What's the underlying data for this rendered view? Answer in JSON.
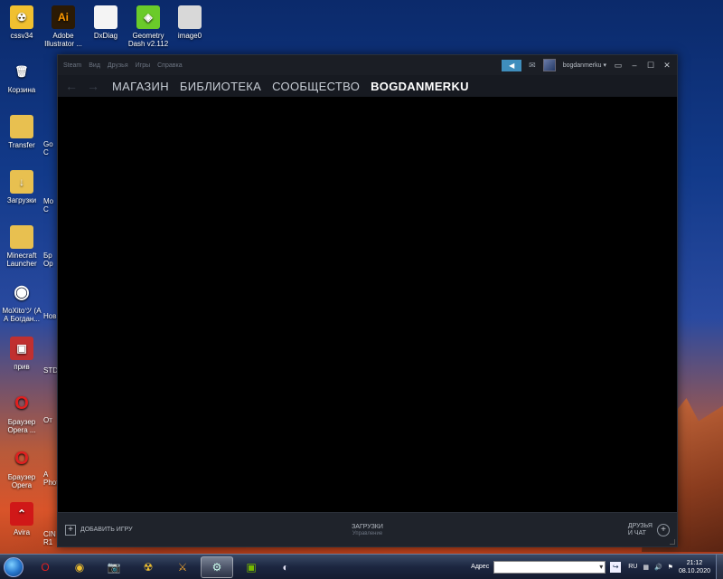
{
  "desktop": {
    "icons": [
      {
        "label": "cssv34",
        "icon": "cs-icon",
        "glyph": "☢",
        "bg": "#f0c030"
      },
      {
        "label": "Adobe Illustrator ...",
        "icon": "illustrator-icon",
        "glyph": "Ai",
        "bg": "#2b1a05"
      },
      {
        "label": "DxDiag",
        "icon": "file-icon",
        "glyph": "",
        "bg": "#f4f4f4"
      },
      {
        "label": "Geometry Dash v2.112",
        "icon": "geometry-dash-icon",
        "glyph": "◈",
        "bg": "#6acb2a"
      },
      {
        "label": "image0",
        "icon": "image-file-icon",
        "glyph": "",
        "bg": "#d8d8d8"
      },
      {
        "label": "Корзина",
        "icon": "recycle-bin-icon",
        "glyph": "🗑",
        "bg": "transparent"
      },
      {
        "label": "Transfer",
        "icon": "folder-icon",
        "glyph": "",
        "bg": "#e8c050"
      },
      {
        "label": "Загрузки",
        "icon": "downloads-folder-icon",
        "glyph": "↓",
        "bg": "#e8c050"
      },
      {
        "label": "Minecraft Launcher",
        "icon": "minecraft-folder-icon",
        "glyph": "",
        "bg": "#e8c050"
      },
      {
        "label": "MoXitoツ (А А Богдан...",
        "icon": "chrome-icon",
        "glyph": "◉",
        "bg": "transparent"
      },
      {
        "label": "прив",
        "icon": "image-icon",
        "glyph": "▣",
        "bg": "#c03030"
      },
      {
        "label": "Браузер Opera ...",
        "icon": "opera-icon",
        "glyph": "O",
        "bg": "transparent"
      },
      {
        "label": "Браузер Opera",
        "icon": "opera-icon",
        "glyph": "O",
        "bg": "transparent"
      },
      {
        "label": "Avira",
        "icon": "avira-icon",
        "glyph": "⌃",
        "bg": "#d01818"
      }
    ],
    "partial_labels": [
      "Go C",
      "Mo C",
      "Бр Op",
      "Нов",
      "STD",
      "От",
      "A Phot",
      "CIN R1"
    ]
  },
  "steam": {
    "menu": [
      "Steam",
      "Вид",
      "Друзья",
      "Игры",
      "Справка"
    ],
    "username": "bogdanmerku",
    "nav_back": "←",
    "nav_forward": "→",
    "nav": [
      "МАГАЗИН",
      "БИБЛИОТЕКА",
      "СООБЩЕСТВО",
      "BOGDANMERKU"
    ],
    "add_game": "ДОБАВИТЬ ИГРУ",
    "downloads": "ЗАГРУЗКИ",
    "downloads_sub": "Управление",
    "friends_line1": "ДРУЗЬЯ",
    "friends_line2": "И ЧАТ",
    "accent_color": "#3f8ebd"
  },
  "taskbar": {
    "address_label": "Адрес",
    "language": "RU",
    "time": "21:12",
    "date": "08.10.2020"
  }
}
